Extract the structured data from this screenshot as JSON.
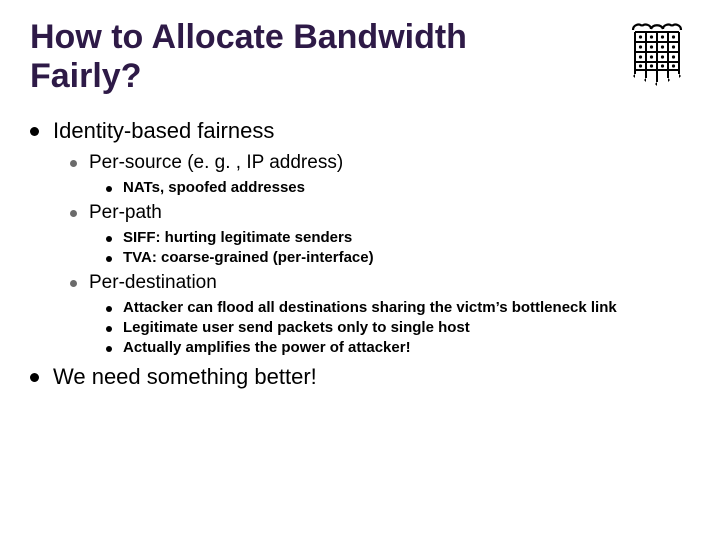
{
  "title": "How to Allocate Bandwidth Fairly?",
  "bullets": {
    "identity": "Identity-based fairness",
    "persource": "Per-source (e. g. , IP address)",
    "nats": "NATs, spoofed addresses",
    "perpath": "Per-path",
    "siff": "SIFF: hurting legitimate senders",
    "tva": "TVA: coarse-grained (per-interface)",
    "perdest": "Per-destination",
    "flood": "Attacker can flood all destinations sharing the victm’s bottleneck link",
    "legit": "Legitimate user send packets only to single host",
    "amplify": "Actually amplifies the power of attacker!",
    "better": "We need something better!"
  }
}
